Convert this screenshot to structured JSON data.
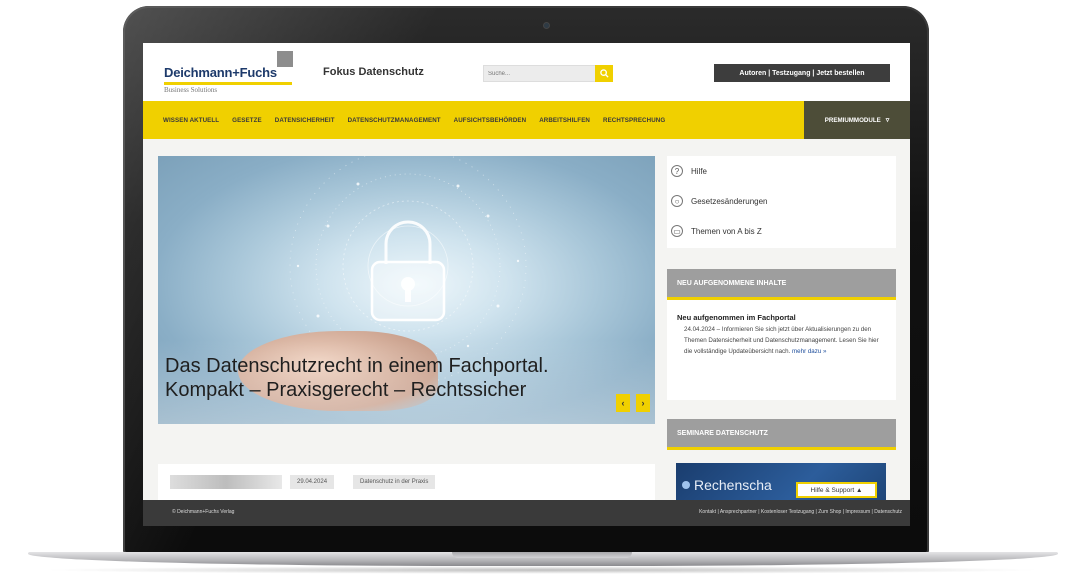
{
  "brand": {
    "logo": "Deichmann+Fuchs",
    "logo_sub": "Business Solutions",
    "site_title": "Fokus Datenschutz"
  },
  "header": {
    "search_placeholder": "Suche...",
    "auth_label": "Autoren | Testzugang | Jetzt bestellen"
  },
  "nav": {
    "items": [
      "WISSEN AKTUELL",
      "GESETZE",
      "DATENSICHERHEIT",
      "DATENSCHUTZMANAGEMENT",
      "AUFSICHTSBEHÖRDEN",
      "ARBEITSHILFEN",
      "RECHTSPRECHUNG"
    ],
    "premium": "PREMIUMMODULE"
  },
  "hero": {
    "line1": "Das Datenschutzrecht in einem Fachportal.",
    "line2": "Kompakt – Praxisgerecht – Rechtssicher",
    "prev": "‹",
    "next": "›"
  },
  "sidebar": {
    "links": [
      {
        "icon": "?",
        "label": "Hilfe"
      },
      {
        "icon": "○",
        "label": "Gesetzesänderungen"
      },
      {
        "icon": "▭",
        "label": "Themen von A bis Z"
      }
    ],
    "new_content": {
      "heading": "NEU AUFGENOMMENE INHALTE",
      "title": "Neu aufgenommen im Fachportal",
      "text": "24.04.2024 – Informieren Sie sich jetzt über Aktualisierungen zu den Themen Datensicherheit und Datenschutzmanagement. Lesen Sie hier die vollständige Updateübersicht nach.",
      "more": "mehr dazu »"
    },
    "seminar": {
      "heading": "SEMINARE DATENSCHUTZ",
      "image_text": "Rechenscha"
    },
    "help_button": "Hilfe & Support ▲"
  },
  "teaser": {
    "date": "29.04.2024",
    "category": "Datenschutz in der Praxis"
  },
  "footer": {
    "copyright": "© Deichmann+Fuchs Verlag",
    "links": "Kontakt | Ansprechpartner | Kostenloser Testzugang | Zum Shop | Impressum | Datenschutz"
  },
  "colors": {
    "accent": "#f0d000",
    "dark": "#3a3a3a",
    "brand_blue": "#1d3a6b"
  }
}
